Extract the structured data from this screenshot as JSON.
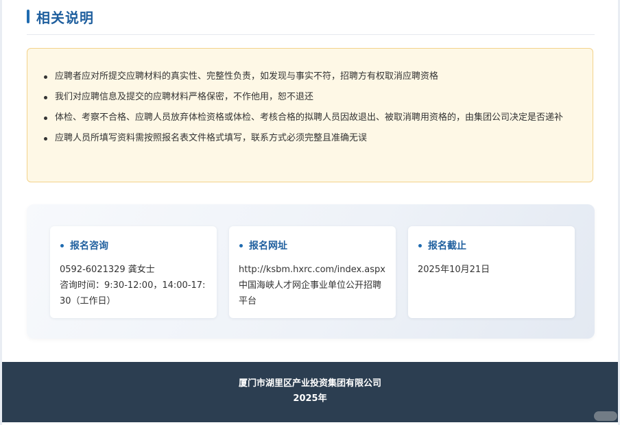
{
  "section": {
    "title": "相关说明"
  },
  "notices": [
    "应聘者应对所提交应聘材料的真实性、完整性负责，如发现与事实不符，招聘方有权取消应聘资格",
    "我们对应聘信息及提交的应聘材料严格保密，不作他用，恕不退还",
    "体检、考察不合格、应聘人员放弃体检资格或体检、考核合格的拟聘人员因故退出、被取消聘用资格的，由集团公司决定是否递补",
    "应聘人员所填写资料需按照报名表文件格式填写，联系方式必须完整且准确无误"
  ],
  "cards": [
    {
      "title": "报名咨询",
      "lines": [
        "0592-6021329 龚女士",
        "咨询时间：9:30-12:00，14:00-17:30（工作日）"
      ]
    },
    {
      "title": "报名网址",
      "lines": [
        "http://ksbm.hxrc.com/index.aspx",
        "中国海峡人才网企事业单位公开招聘平台"
      ]
    },
    {
      "title": "报名截止",
      "lines": [
        "2025年10月21日"
      ]
    }
  ],
  "footer": {
    "company": "厦门市湖里区产业投资集团有限公司",
    "year": "2025年"
  },
  "colors": {
    "accent": "#1f5f9e",
    "notice_bg": "#fef8e6",
    "notice_border": "#f3d28a",
    "footer_bg": "#2c3e51"
  }
}
